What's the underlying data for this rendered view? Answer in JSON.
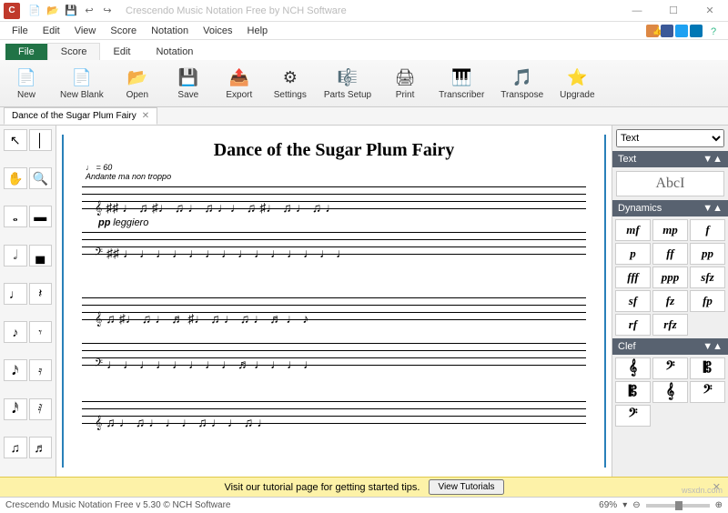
{
  "titlebar": {
    "title": "Crescendo Music Notation Free by NCH Software"
  },
  "menu": [
    "File",
    "Edit",
    "View",
    "Score",
    "Notation",
    "Voices",
    "Help"
  ],
  "ribbon_tabs": {
    "file": "File",
    "items": [
      "Score",
      "Edit",
      "Notation"
    ],
    "active": "Score"
  },
  "toolbar": [
    {
      "icon": "📄",
      "label": "New"
    },
    {
      "icon": "📄",
      "label": "New Blank"
    },
    {
      "icon": "📂",
      "label": "Open"
    },
    {
      "icon": "💾",
      "label": "Save"
    },
    {
      "icon": "📤",
      "label": "Export"
    },
    {
      "icon": "⚙️",
      "label": "Settings"
    },
    {
      "icon": "🎼",
      "label": "Parts Setup"
    },
    {
      "icon": "🖨",
      "label": "Print"
    },
    {
      "icon": "🎹",
      "label": "Transcriber"
    },
    {
      "icon": "🎵",
      "label": "Transpose"
    },
    {
      "icon": "⭐",
      "label": "Upgrade"
    }
  ],
  "doc_tab": {
    "name": "Dance of the Sugar Plum Fairy"
  },
  "score": {
    "title": "Dance of the Sugar Plum Fairy",
    "tempo_bpm": "♩ = 60",
    "tempo_text": "Andante ma non troppo",
    "dynamic": "pp",
    "dynamic_text": "leggiero"
  },
  "right": {
    "dropdown": "Text",
    "text_section": {
      "header": "Text",
      "sample": "AbcI"
    },
    "dynamics": {
      "header": "Dynamics",
      "items": [
        "mf",
        "mp",
        "f",
        "p",
        "ff",
        "pp",
        "fff",
        "ppp",
        "sfz",
        "sf",
        "fz",
        "fp",
        "rf",
        "rfz"
      ]
    },
    "clef": {
      "header": "Clef",
      "items": [
        "𝄞",
        "𝄢",
        "𝄡",
        "𝄡",
        "𝄞",
        "𝄢",
        "𝄢"
      ]
    }
  },
  "promo": {
    "text": "Visit our tutorial page for getting started tips.",
    "button": "View Tutorials"
  },
  "status": {
    "text": "Crescendo Music Notation Free v 5.30 © NCH Software",
    "zoom": "69%"
  },
  "watermark": "wsxdn.com"
}
